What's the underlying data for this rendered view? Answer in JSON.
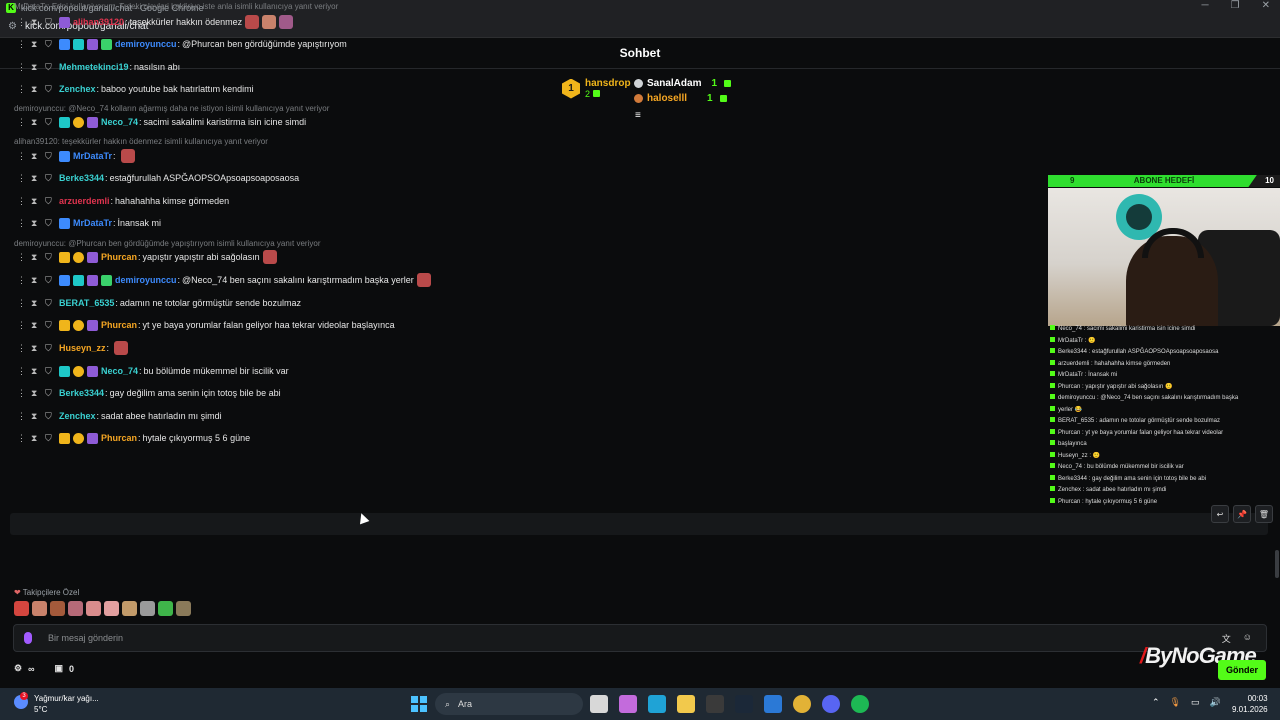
{
  "window": {
    "title": "kick.com/popout/ganali/chat - Google Chrome",
    "url": "kick.com/popout/ganali/chat",
    "controls": [
      "─",
      "❐",
      "✕"
    ]
  },
  "chat": {
    "header": "Sohbet"
  },
  "leaderboard": {
    "first": {
      "rank": "1",
      "name": "hansdrop",
      "count": "2"
    },
    "others": [
      {
        "name": "SanalAdam",
        "count": "1"
      },
      {
        "name": "haloselll",
        "count": "1"
      }
    ]
  },
  "messages": [
    {
      "reply": "MrDataTr: Edpi kullaniyorum. Trdeki olaylari kaldiriyo iste anla isimli kullanıcıya yanıt veriyor"
    },
    {
      "user": "alihan39120",
      "color": "#e0344f",
      "text": "teşekkürler hakkın ödenmez",
      "badges": [
        "purple"
      ],
      "emotes": 3
    },
    {
      "user": "demiroyunccu",
      "color": "#3d8bfd",
      "text": "@Phurcan ben gördüğümde yapıştırıyom",
      "badges": [
        "blue",
        "teal",
        "purple",
        "green"
      ]
    },
    {
      "user": "Mehmetekinci19",
      "color": "#3ad1d1",
      "text": "nasılsın abı",
      "badges": []
    },
    {
      "user": "Zenchex",
      "color": "#3ad1d1",
      "text": "baboo youtube bak hatırlattım kendimi",
      "badges": []
    },
    {
      "reply": "demiroyunccu: @Neco_74 kolların ağarmış daha ne istiyon isimli kullanıcıya yanıt veriyor"
    },
    {
      "user": "Neco_74",
      "color": "#3ad1d1",
      "text": "sacimi sakalimi karistirma isin icine simdi",
      "badges": [
        "teal",
        "gold",
        "purple"
      ]
    },
    {
      "reply": "alihan39120: teşekkürler hakkın ödenmez isimli kullanıcıya yanıt veriyor"
    },
    {
      "user": "MrDataTr",
      "color": "#3d8bfd",
      "text": "",
      "badges": [
        "blue"
      ],
      "emotes": 1
    },
    {
      "user": "Berke3344",
      "color": "#3ad1d1",
      "text": "estağfurullah ASPĞAOPSOApsoapsoaposaosa",
      "badges": []
    },
    {
      "user": "arzuerdemli",
      "color": "#e0344f",
      "text": "hahahahha kimse görmeden",
      "badges": []
    },
    {
      "user": "MrDataTr",
      "color": "#3d8bfd",
      "text": "İnansak mi",
      "badges": [
        "blue"
      ]
    },
    {
      "reply": "demiroyunccu: @Phurcan ben gördüğümde yapıştırıyom isimli kullanıcıya yanıt veriyor"
    },
    {
      "user": "Phurcan",
      "color": "#f5a623",
      "text": "yapıştır yapıştır abi sağolasın",
      "badges": [
        "crown",
        "gold",
        "purple"
      ],
      "emotes": 1
    },
    {
      "user": "demiroyunccu",
      "color": "#3d8bfd",
      "text": "@Neco_74 ben saçını sakalını karıştırmadım başka yerler",
      "badges": [
        "blue",
        "teal",
        "purple",
        "green"
      ],
      "emotes": 1
    },
    {
      "user": "BERAT_6535",
      "color": "#3ad1d1",
      "text": "adamın ne totolar görmüştür sende bozulmaz",
      "badges": []
    },
    {
      "user": "Phurcan",
      "color": "#f5a623",
      "text": "yt ye baya yorumlar falan geliyor haa tekrar videolar başlayınca",
      "badges": [
        "crown",
        "gold",
        "purple"
      ]
    },
    {
      "user": "Huseyn_zz",
      "color": "#f5a623",
      "text": "",
      "badges": [],
      "emotes": 1
    },
    {
      "user": "Neco_74",
      "color": "#3ad1d1",
      "text": "bu bölümde mükemmel bir iscilik var",
      "badges": [
        "teal",
        "gold",
        "purple"
      ]
    },
    {
      "user": "Berke3344",
      "color": "#3ad1d1",
      "text": "gay değilim ama senin için totoş bile be abi",
      "badges": []
    },
    {
      "user": "Zenchex",
      "color": "#3ad1d1",
      "text": "sadat abee hatırladın mı şimdi",
      "badges": []
    },
    {
      "user": "Phurcan",
      "color": "#f5a623",
      "text": "hytale çıkıyormuş 5 6 güne",
      "badges": [
        "crown",
        "gold",
        "purple"
      ]
    }
  ],
  "follower_emotes_label": "Takipçilere Özel",
  "input": {
    "placeholder": "Bir mesaj gönderin"
  },
  "bottom": {
    "count": "0",
    "send": "Gönder"
  },
  "overlay": {
    "sub_goal": {
      "label": "ABONE HEDEFİ",
      "current": "9",
      "target": "10",
      "progress": 0.9
    },
    "chat": [
      "Neco_74 : sacimi sakalimi karistirma isin icine simdi",
      "MrDataTr : 🙂",
      "Berke3344 : estağfurullah ASPĞAOPSOApsoapsoaposaosa",
      "arzuerdemli : hahahahha kimse görmeden",
      "MrDataTr : İnansak mi",
      "Phurcan : yapıştır yapıştır abi sağolasın 🙂",
      "demiroyunccu : @Neco_74 ben saçını sakalını karıştırmadım başka",
      "yerler 😂",
      "BERAT_6535 : adamın ne totolar görmüştür sende bozulmaz",
      "Phurcan : yt ye baya yorumlar falan geliyor haa tekrar videolar",
      "başlayınca",
      "Huseyn_zz : 🙂",
      "Neco_74 : bu bölümde mükemmel bir iscilik var",
      "Berke3344 : gay değilim ama senin için totoş bile be abi",
      "Zenchex : sadat abee hatırladın mı şimdi",
      "Phurcan : hytale çıkıyormuş 5 6 güne"
    ]
  },
  "watermark": "ByNoGame",
  "taskbar": {
    "weather_title": "Yağmur/kar yağı...",
    "weather_temp": "5°C",
    "weather_badge": "3",
    "search": "Ara",
    "time": "00:03",
    "date": "9.01.2026"
  },
  "colors": {
    "accent": "#53fc18",
    "background": "#0b0c0d"
  }
}
